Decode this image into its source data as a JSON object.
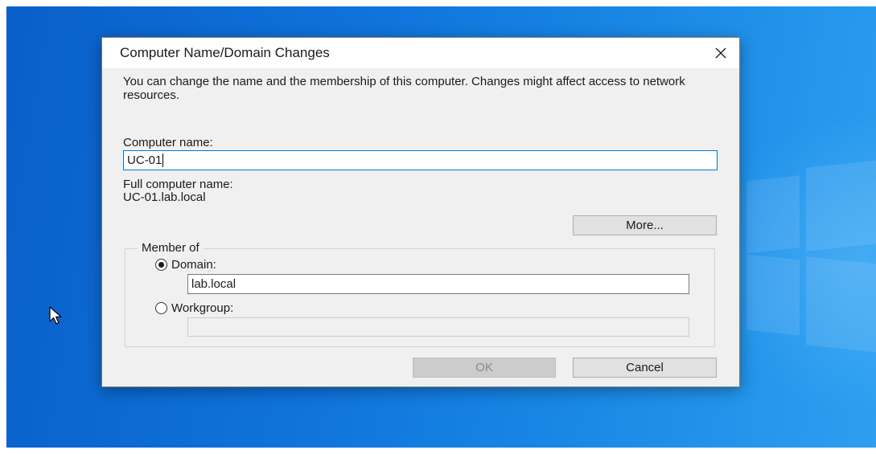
{
  "dialog": {
    "title": "Computer Name/Domain Changes",
    "description": "You can change the name and the membership of this computer. Changes might affect access to network resources.",
    "computer_name_label": "Computer name:",
    "computer_name_value": "UC-01",
    "full_name_label": "Full computer name:",
    "full_name_value": "UC-01.lab.local",
    "more_button": "More...",
    "member_of": {
      "legend": "Member of",
      "domain_label": "Domain:",
      "domain_value": "lab.local",
      "domain_selected": true,
      "workgroup_label": "Workgroup:",
      "workgroup_value": ""
    },
    "ok_button": "OK",
    "cancel_button": "Cancel"
  },
  "icons": {
    "close": "close-icon",
    "cursor": "mouse-pointer-icon"
  },
  "colors": {
    "desktop_blue": "#0f74dc",
    "focus_border": "#0078d7",
    "dialog_bg": "#f0f0f0"
  }
}
